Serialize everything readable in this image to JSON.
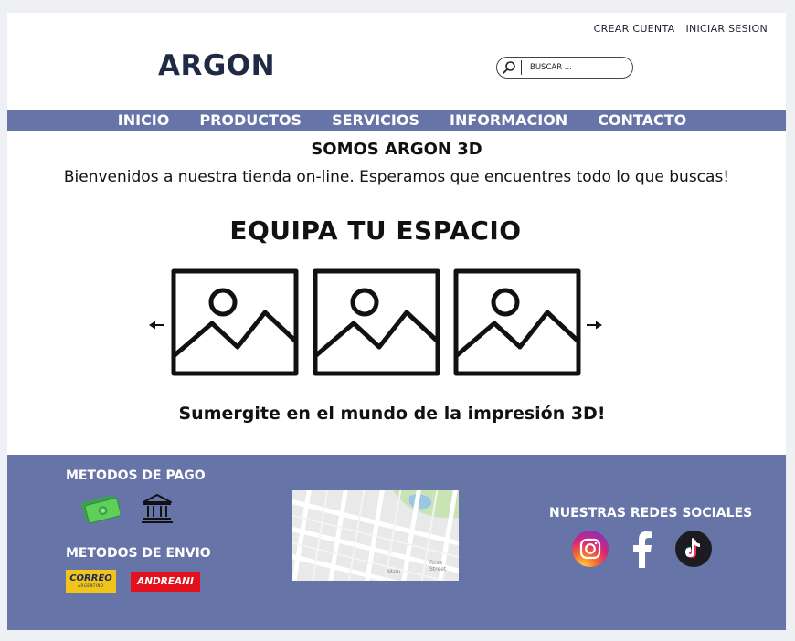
{
  "header": {
    "top_links": [
      "CREAR CUENTA",
      "INICIAR SESION"
    ],
    "logo": "ARGON",
    "search": {
      "placeholder": "BUSCAR ..."
    }
  },
  "nav": {
    "items": [
      "INICIO",
      "PRODUCTOS",
      "SERVICIOS",
      "INFORMACION",
      "CONTACTO"
    ]
  },
  "main": {
    "headline": "SOMOS ARGON 3D",
    "welcome": "Bienvenidos a nuestra tienda on-line. Esperamos que encuentres todo lo que buscas!",
    "section_title": "EQUIPA TU ESPACIO",
    "tagline": "Sumergite en el mundo de la impresión 3D!"
  },
  "footer": {
    "payment_title": "METODOS DE PAGO",
    "shipping_title": "METODOS DE ENVIO",
    "shipping": {
      "correo": "CORREO",
      "correo_sub": "ARGENTINO",
      "andreani": "ANDREANI"
    },
    "social_title": "NUESTRAS REDES SOCIALES",
    "map_labels": [
      "Main",
      "Rose Street"
    ]
  },
  "colors": {
    "nav_bg": "#6674a8",
    "logo": "#1f2a44",
    "correo_yellow": "#f0c419",
    "andreani_red": "#e3101e"
  },
  "icons": [
    "search-icon",
    "arrow-left-icon",
    "arrow-right-icon",
    "image-placeholder-icon",
    "money-icon",
    "bank-icon",
    "instagram-icon",
    "facebook-icon",
    "tiktok-icon"
  ]
}
